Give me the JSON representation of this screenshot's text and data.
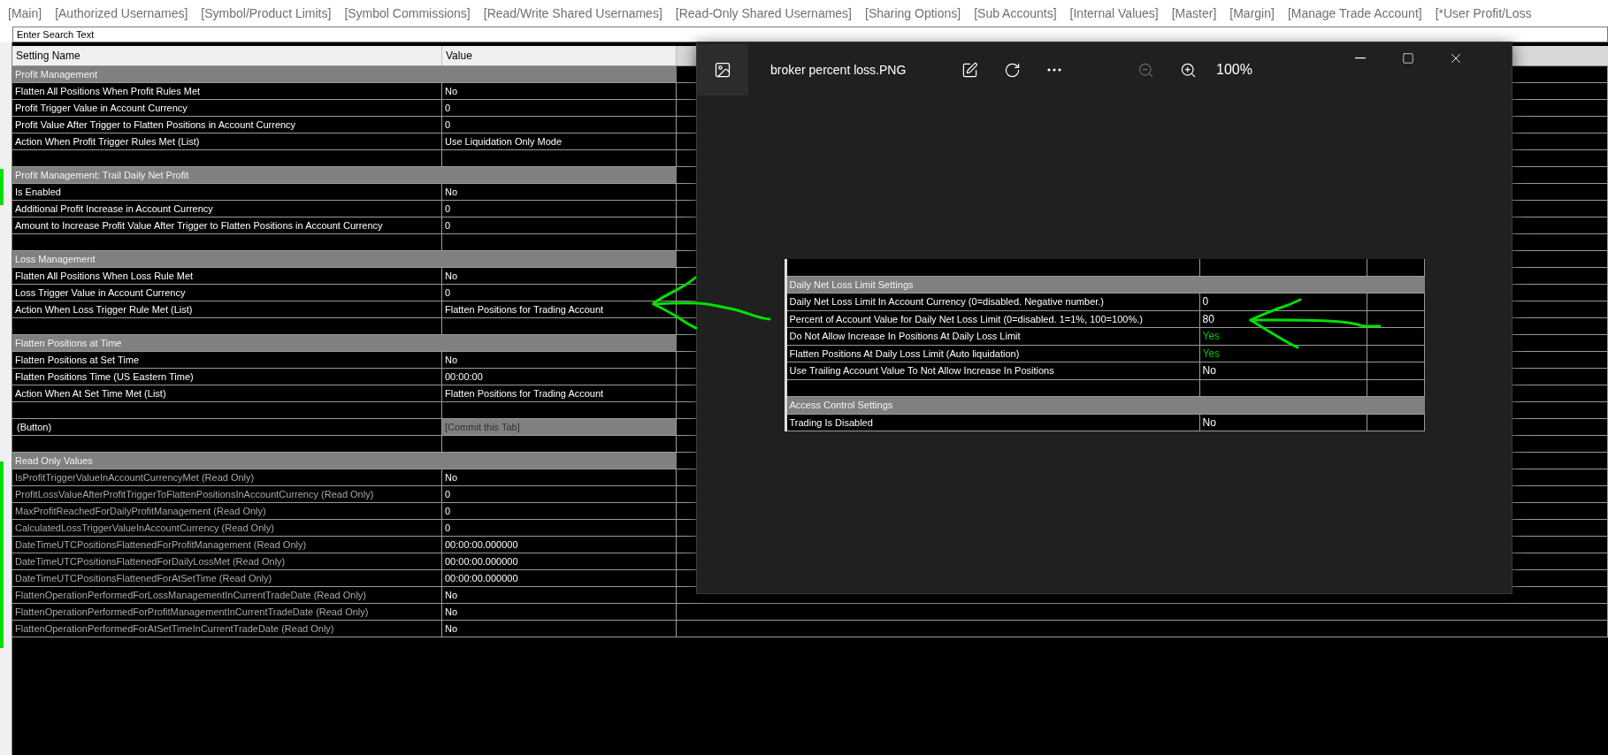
{
  "tabs": [
    {
      "label": "[Main]",
      "selected": false
    },
    {
      "label": "[Authorized Usernames]",
      "selected": false
    },
    {
      "label": "[Symbol/Product Limits]",
      "selected": false
    },
    {
      "label": "[Symbol Commissions]",
      "selected": false
    },
    {
      "label": "[Read/Write Shared Usernames]",
      "selected": false
    },
    {
      "label": "[Read-Only Shared Usernames]",
      "selected": false
    },
    {
      "label": "[Sharing Options]",
      "selected": false
    },
    {
      "label": "[Sub Accounts]",
      "selected": false
    },
    {
      "label": "[Internal Values]",
      "selected": false
    },
    {
      "label": "[Master]",
      "selected": false
    },
    {
      "label": "[Margin]",
      "selected": false
    },
    {
      "label": "[Manage Trade Account]",
      "selected": false
    },
    {
      "label": "[*User Profit/Loss",
      "selected": false
    }
  ],
  "search": {
    "placeholder": "Enter Search Text"
  },
  "table": {
    "columns": [
      "Setting Name",
      "Value"
    ],
    "rows": [
      {
        "kind": "section",
        "name": "Profit Management"
      },
      {
        "kind": "setting",
        "name": "Flatten All Positions When Profit Rules Met",
        "value": "No"
      },
      {
        "kind": "setting",
        "name": "Profit Trigger Value in Account Currency",
        "value": "0"
      },
      {
        "kind": "setting",
        "name": "Profit Value After Trigger to Flatten Positions in Account Currency",
        "value": "0"
      },
      {
        "kind": "setting",
        "name": "Action When Profit Trigger Rules Met (List)",
        "value": "Use Liquidation Only Mode"
      },
      {
        "kind": "blank"
      },
      {
        "kind": "section",
        "name": "Profit Management: Trail Daily Net Profit"
      },
      {
        "kind": "setting",
        "name": "Is Enabled",
        "value": "No"
      },
      {
        "kind": "setting",
        "name": "Additional Profit Increase in Account Currency",
        "value": "0"
      },
      {
        "kind": "setting",
        "name": "Amount to Increase Profit Value After Trigger to Flatten Positions in Account Currency",
        "value": "0"
      },
      {
        "kind": "blank"
      },
      {
        "kind": "section",
        "name": "Loss Management"
      },
      {
        "kind": "setting",
        "name": "Flatten All Positions When Loss Rule Met",
        "value": "No"
      },
      {
        "kind": "setting",
        "name": "Loss Trigger Value in Account Currency",
        "value": "0"
      },
      {
        "kind": "setting",
        "name": "Action When Loss Trigger Rule Met (List)",
        "value": "Flatten Positions for Trading Account"
      },
      {
        "kind": "blank"
      },
      {
        "kind": "section",
        "name": "Flatten Positions at Time"
      },
      {
        "kind": "setting",
        "name": "Flatten Positions at Set Time",
        "value": "No"
      },
      {
        "kind": "setting",
        "name": "Flatten Positions Time (US Eastern Time)",
        "value": "00:00:00"
      },
      {
        "kind": "setting",
        "name": "Action When At Set Time Met (List)",
        "value": "Flatten Positions for Trading Account"
      },
      {
        "kind": "blank"
      },
      {
        "kind": "button",
        "name": "(Button)",
        "value": "[Commit this Tab]"
      },
      {
        "kind": "blank"
      },
      {
        "kind": "section",
        "name": "Read Only Values"
      },
      {
        "kind": "readonly",
        "name": "IsProfitTriggerValueInAccountCurrencyMet (Read Only)",
        "value": "No"
      },
      {
        "kind": "readonly",
        "name": "ProfitLossValueAfterProfitTriggerToFlattenPositionsInAccountCurrency (Read Only)",
        "value": "0"
      },
      {
        "kind": "readonly",
        "name": "MaxProfitReachedForDailyProfitManagement (Read Only)",
        "value": "0"
      },
      {
        "kind": "readonly",
        "name": "CalculatedLossTriggerValueInAccountCurrency (Read Only)",
        "value": "0"
      },
      {
        "kind": "readonly",
        "name": "DateTimeUTCPositionsFlattenedForProfitManagement (Read Only)",
        "value": "00:00:00.000000"
      },
      {
        "kind": "readonly",
        "name": "DateTimeUTCPositionsFlattenedForDailyLossMet (Read Only)",
        "value": "00:00:00.000000"
      },
      {
        "kind": "readonly",
        "name": "DateTimeUTCPositionsFlattenedForAtSetTime (Read Only)",
        "value": "00:00:00.000000"
      },
      {
        "kind": "readonly",
        "name": "FlattenOperationPerformedForLossManagementInCurrentTradeDate (Read Only)",
        "value": "No"
      },
      {
        "kind": "readonly",
        "name": "FlattenOperationPerformedForProfitManagementInCurrentTradeDate (Read Only)",
        "value": "No"
      },
      {
        "kind": "readonly",
        "name": "FlattenOperationPerformedForAtSetTimeInCurrentTradeDate (Read Only)",
        "value": "No"
      }
    ]
  },
  "viewer": {
    "title": "broker percent loss.PNG",
    "zoom": "100%",
    "zoom_out_disabled": true,
    "image_rows": [
      {
        "kind": "blank"
      },
      {
        "kind": "section",
        "name": "Daily Net Loss Limit Settings"
      },
      {
        "kind": "setting",
        "name": "Daily Net Loss Limit In Account Currency (0=disabled. Negative number.)",
        "value": "0"
      },
      {
        "kind": "setting",
        "name": "Percent of Account Value for Daily Net Loss Limit (0=disabled. 1=1%, 100=100%.)",
        "value": "80"
      },
      {
        "kind": "setting",
        "name": "Do Not Allow Increase In Positions At Daily Loss Limit",
        "value": "Yes",
        "color": "#00c800"
      },
      {
        "kind": "setting",
        "name": "Flatten Positions At Daily Loss Limit (Auto liquidation)",
        "value": "Yes",
        "color": "#00c800"
      },
      {
        "kind": "setting",
        "name": "Use Trailing Account Value To Not Allow Increase In Positions",
        "value": "No"
      },
      {
        "kind": "blank"
      },
      {
        "kind": "section",
        "name": "Access Control Settings"
      },
      {
        "kind": "setting",
        "name": "Trading Is Disabled",
        "value": "No"
      }
    ]
  }
}
